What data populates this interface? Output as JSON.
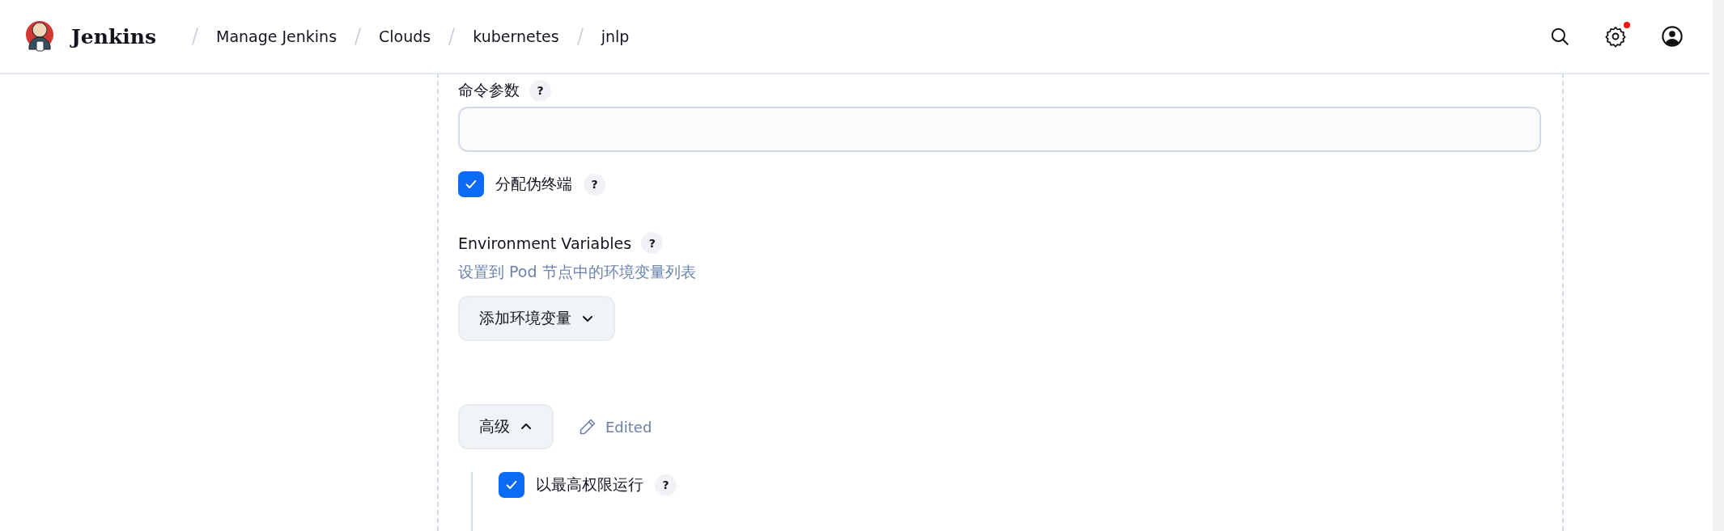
{
  "header": {
    "logo_text": "Jenkins",
    "breadcrumbs": [
      "Manage Jenkins",
      "Clouds",
      "kubernetes",
      "jnlp"
    ],
    "settings_notification": true
  },
  "form": {
    "command_args": {
      "label": "命令参数",
      "help": "?"
    },
    "pseudo_tty": {
      "label": "分配伪终端",
      "checked": true,
      "help": "?"
    },
    "env": {
      "label": "Environment Variables",
      "help": "?",
      "description": "设置到 Pod 节点中的环境变量列表",
      "add_button": "添加环境变量"
    },
    "advanced": {
      "label": "高级",
      "expanded": true,
      "edited": "Edited"
    },
    "privileged": {
      "label": "以最高权限运行",
      "checked": true,
      "help": "?"
    }
  }
}
